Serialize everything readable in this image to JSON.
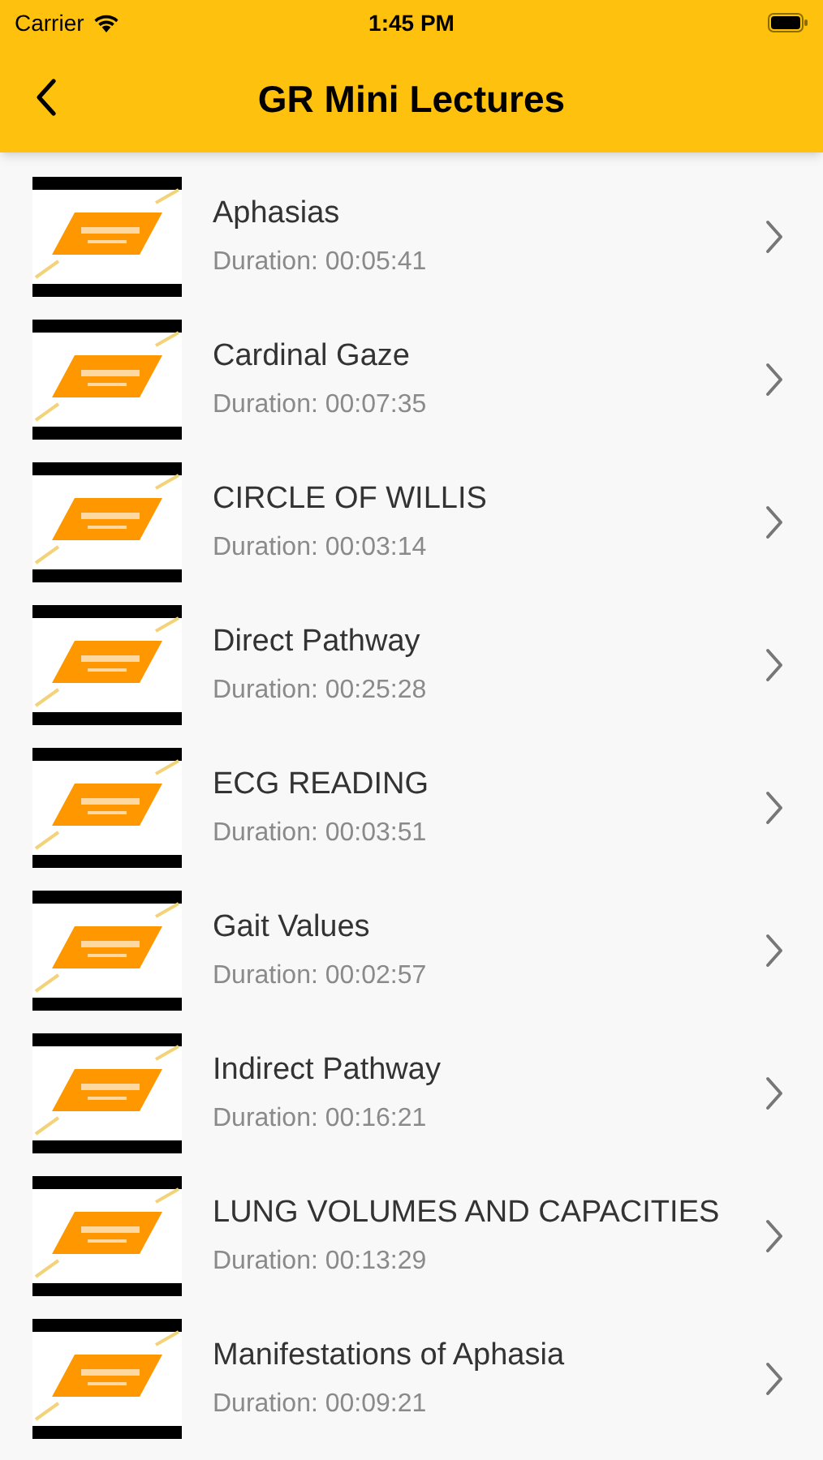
{
  "status_bar": {
    "carrier": "Carrier",
    "time": "1:45 PM"
  },
  "nav": {
    "title": "GR Mini Lectures"
  },
  "lectures": [
    {
      "title": "Aphasias",
      "duration": "Duration: 00:05:41"
    },
    {
      "title": "Cardinal Gaze",
      "duration": "Duration: 00:07:35"
    },
    {
      "title": "CIRCLE OF WILLIS",
      "duration": "Duration: 00:03:14"
    },
    {
      "title": "Direct Pathway",
      "duration": "Duration: 00:25:28"
    },
    {
      "title": "ECG READING",
      "duration": "Duration: 00:03:51"
    },
    {
      "title": "Gait Values",
      "duration": "Duration: 00:02:57"
    },
    {
      "title": "Indirect Pathway",
      "duration": "Duration: 00:16:21"
    },
    {
      "title": "LUNG VOLUMES AND CAPACITIES",
      "duration": "Duration: 00:13:29"
    },
    {
      "title": "Manifestations of Aphasia",
      "duration": "Duration: 00:09:21"
    }
  ]
}
